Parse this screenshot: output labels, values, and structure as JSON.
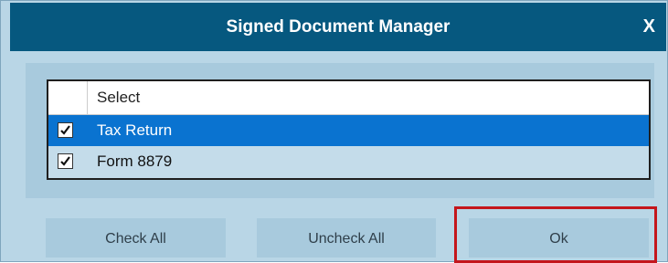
{
  "dialog": {
    "title": "Signed Document Manager",
    "close_label": "X"
  },
  "grid": {
    "column_header": "Select",
    "rows": [
      {
        "label": "Tax Return",
        "checked": true,
        "selected": true
      },
      {
        "label": "Form 8879",
        "checked": true,
        "selected": false
      }
    ]
  },
  "buttons": {
    "check_all": "Check All",
    "uncheck_all": "Uncheck All",
    "ok": "Ok"
  },
  "colors": {
    "titlebar": "#06587f",
    "dialog_bg": "#b9d6e6",
    "selected_row": "#0a73d0",
    "highlight_box": "#c4161c"
  }
}
